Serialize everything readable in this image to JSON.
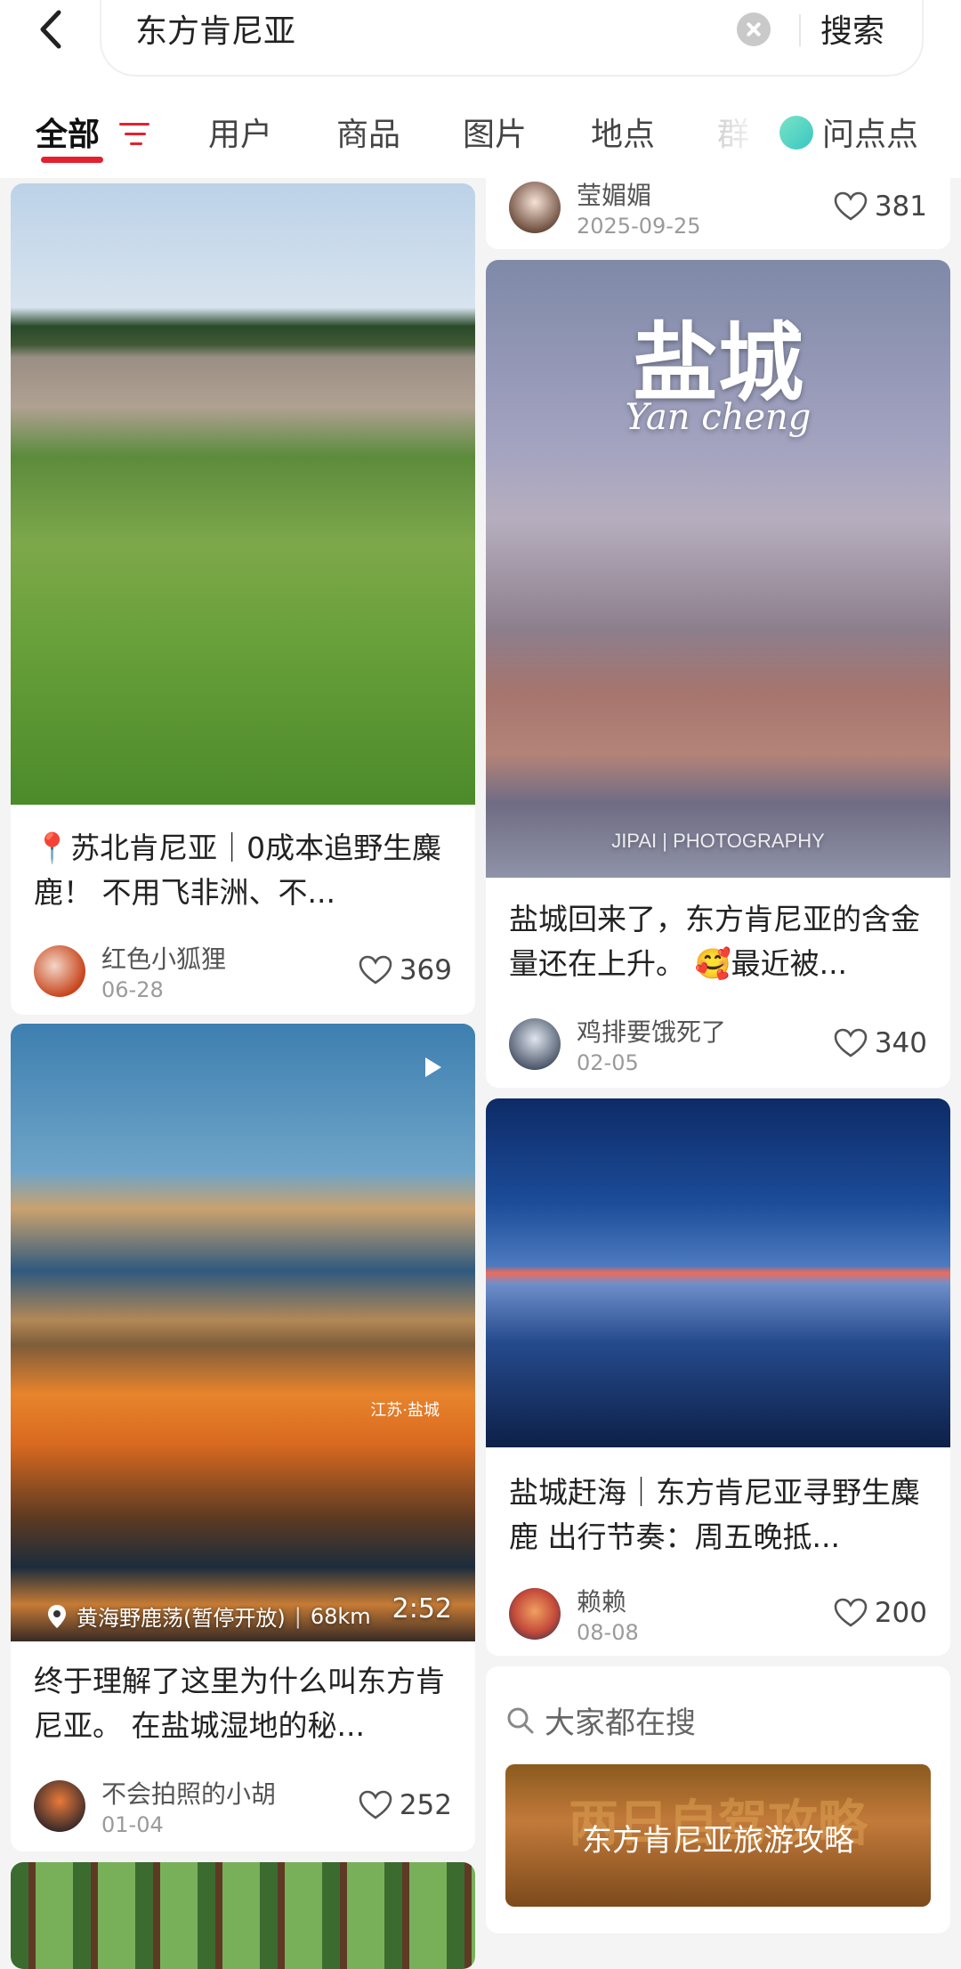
{
  "header": {
    "search_value": "东方肯尼亚",
    "search_button": "搜索"
  },
  "tabs": [
    {
      "label": "全部"
    },
    {
      "label": "用户"
    },
    {
      "label": "商品"
    },
    {
      "label": "图片"
    },
    {
      "label": "地点"
    },
    {
      "label": "群"
    },
    {
      "label": "问点点"
    }
  ],
  "feed": {
    "left": [
      {
        "title": "📍苏北肯尼亚｜0成本追野生麋鹿！ 不用飞非洲、不...",
        "author": "红色小狐狸",
        "date": "06-28",
        "likes": "369"
      },
      {
        "location": "黄海野鹿荡(暂停开放)",
        "distance": "68km",
        "duration": "2:52",
        "image_tag": "江苏·盐城",
        "title": "终于理解了这里为什么叫东方肯尼亚。 在盐城湿地的秘...",
        "author": "不会拍照的小胡",
        "date": "01-04",
        "likes": "252"
      }
    ],
    "right": [
      {
        "author": "莹媚媚",
        "date": "2025-09-25",
        "likes": "381"
      },
      {
        "image_title": "盐城",
        "image_subtitle": "Yan cheng",
        "image_footer": "JIPAI  |  PHOTOGRAPHY",
        "title": "盐城回来了，东方肯尼亚的含金量还在上升。 🥰最近被...",
        "author": "鸡排要饿死了",
        "date": "02-05",
        "likes": "340"
      },
      {
        "title": "盐城赶海｜东方肯尼亚寻野生麋鹿 出行节奏：周五晚抵...",
        "author": "赖赖",
        "date": "08-08",
        "likes": "200"
      }
    ],
    "search_suggest": {
      "heading": "大家都在搜",
      "bg_text": "两日自驾攻略",
      "item": "东方肯尼亚旅游攻略"
    }
  },
  "colors": {
    "accent": "#e5202e"
  }
}
